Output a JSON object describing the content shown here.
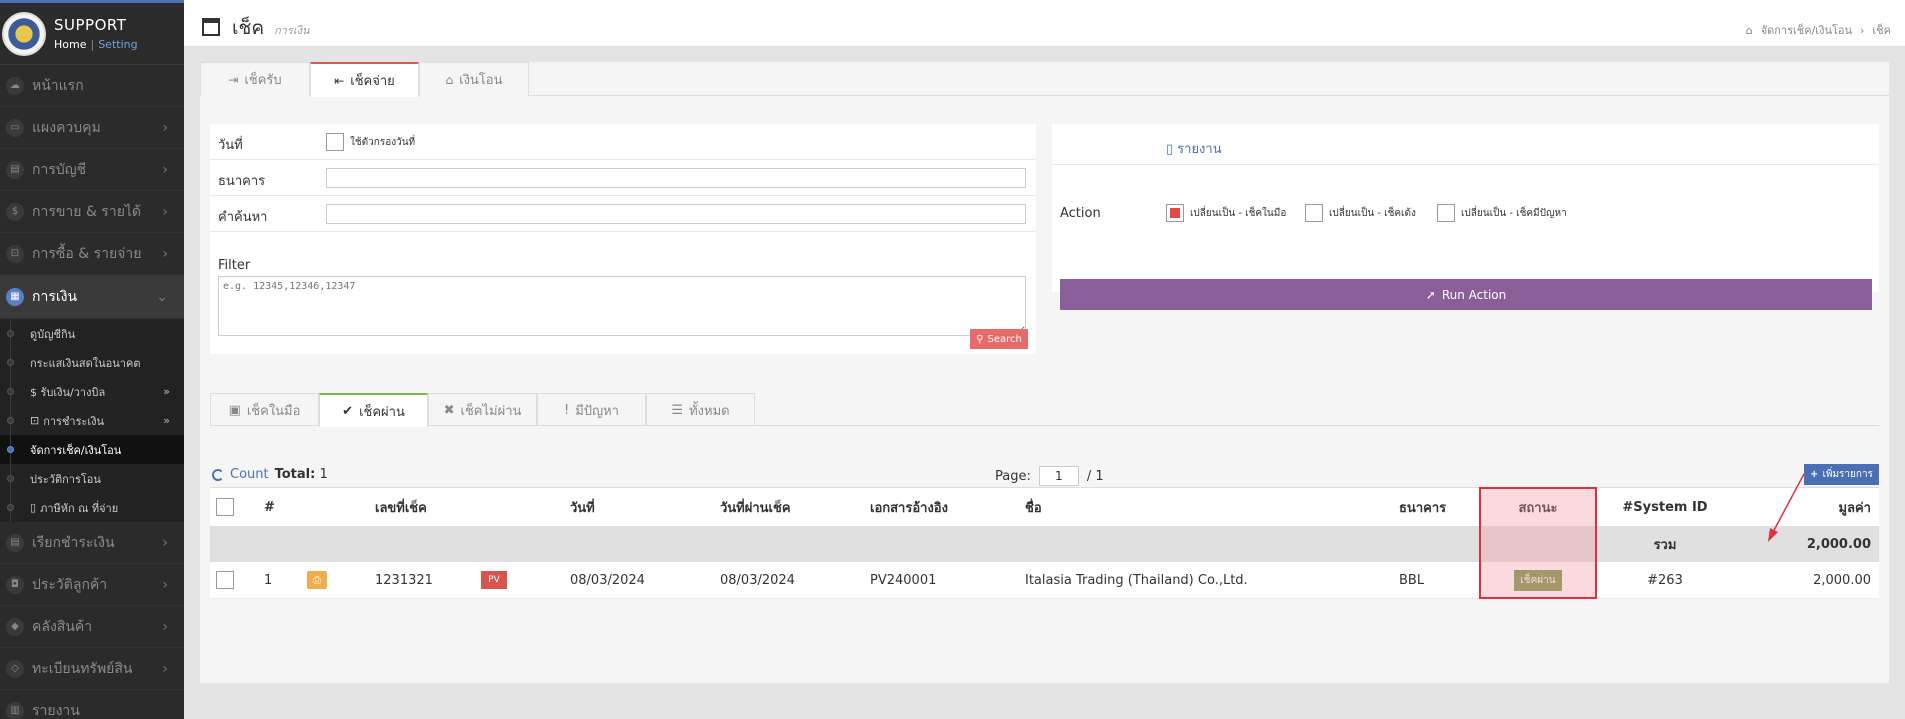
{
  "brand": {
    "title": "SUPPORT",
    "home": "Home",
    "separator": "|",
    "setting": "Setting"
  },
  "sidebar": {
    "items": [
      {
        "label": "หน้าแรก",
        "icon": "cloud-icon"
      },
      {
        "label": "แผงควบคุม",
        "icon": "monitor-icon"
      },
      {
        "label": "การบัญชี",
        "icon": "book-icon"
      },
      {
        "label": "การขาย & รายได้",
        "icon": "dollar-icon"
      },
      {
        "label": "การซื้อ & รายจ่าย",
        "icon": "cart-icon"
      },
      {
        "label": "การเงิน",
        "icon": "calendar-icon"
      },
      {
        "label": "เรียกชำระเงิน",
        "icon": "invoice-icon"
      },
      {
        "label": "ประวัติลูกค้า",
        "icon": "user-icon"
      },
      {
        "label": "คลังสินค้า",
        "icon": "cubes-icon"
      },
      {
        "label": "ทะเบียนทรัพย์สิน",
        "icon": "diamond-icon"
      },
      {
        "label": "รายงาน",
        "icon": "report-icon"
      }
    ],
    "sub_items": [
      {
        "label": "ดูบัญชีกิน"
      },
      {
        "label": "กระแสเงินสดในอนาคต"
      },
      {
        "label": "$ รับเงิน/วางบิล"
      },
      {
        "label": "การชำระเงิน"
      },
      {
        "label": "จัดการเช็ค/เงินโอน"
      },
      {
        "label": "ประวัติการโอน"
      },
      {
        "label": "ภาษีหัก ณ ที่จ่าย"
      }
    ]
  },
  "header": {
    "title": "เช็ค",
    "subtitle": "การเงิน",
    "breadcrumb": {
      "section": "จัดการเช็ค/เงินโอน",
      "separator": "›",
      "current": "เช็ค"
    }
  },
  "top_tabs": [
    {
      "label": "เช็ครับ",
      "icon": "sign-in-icon"
    },
    {
      "label": "เช็คจ่าย",
      "icon": "sign-out-icon"
    },
    {
      "label": "เงินโอน",
      "icon": "bank-icon"
    }
  ],
  "filters": {
    "date_label": "วันที่",
    "date_checkbox_label": "ใช้ตัวกรองวันที่",
    "bank_label": "ธนาคาร",
    "bank_value": "",
    "search_label": "คำค้นหา",
    "search_value": "",
    "filter_label": "Filter",
    "filter_placeholder": "e.g. 12345,12346,12347",
    "search_button": "Search"
  },
  "action_panel": {
    "report_link": "รายงาน",
    "action_label": "Action",
    "options": [
      {
        "label": "เปลี่ยนเป็น - เช็คในมือ",
        "checked": true
      },
      {
        "label": "เปลี่ยนเป็น - เช็คเด้ง",
        "checked": false
      },
      {
        "label": "เปลี่ยนเป็น - เช็คมีปัญหา",
        "checked": false
      }
    ],
    "run_button": "Run Action"
  },
  "status_tabs": [
    {
      "label": "เช็คในมือ",
      "icon": "money-icon"
    },
    {
      "label": "เช็คผ่าน",
      "icon": "check-icon"
    },
    {
      "label": "เช็คไม่ผ่าน",
      "icon": "x-icon"
    },
    {
      "label": "มีปัญหา",
      "icon": "exclamation-icon"
    },
    {
      "label": "ทั้งหมด",
      "icon": "list-icon"
    }
  ],
  "list_info": {
    "count_label": "Count",
    "total_label": "Total:",
    "total_value": "1",
    "page_label": "Page:",
    "page_value": "1",
    "page_total": "/ 1",
    "add_button": "เพิ่มรายการ"
  },
  "table": {
    "columns": [
      "#",
      "เลขที่เช็ค",
      "วันที่",
      "วันที่ผ่านเช็ค",
      "เอกสารอ้างอิง",
      "ชื่อ",
      "ธนาคาร",
      "สถานะ",
      "#System ID",
      "มูลค่า"
    ],
    "summary": {
      "label": "รวม",
      "amount": "2,000.00"
    },
    "rows": [
      {
        "no": "1",
        "cheque_no": "1231321",
        "doc_type": "PV",
        "date": "08/03/2024",
        "cleared_date": "08/03/2024",
        "reference": "PV240001",
        "name": "Italasia Trading (Thailand) Co.,Ltd.",
        "bank": "BBL",
        "status": "เช็คผ่าน",
        "system_id": "#263",
        "amount": "2,000.00"
      }
    ]
  },
  "colors": {
    "accent": "#4a6fb5",
    "run_button": "#8a5f99",
    "status_passed": "#7a9a4a",
    "highlight": "#e03040"
  }
}
